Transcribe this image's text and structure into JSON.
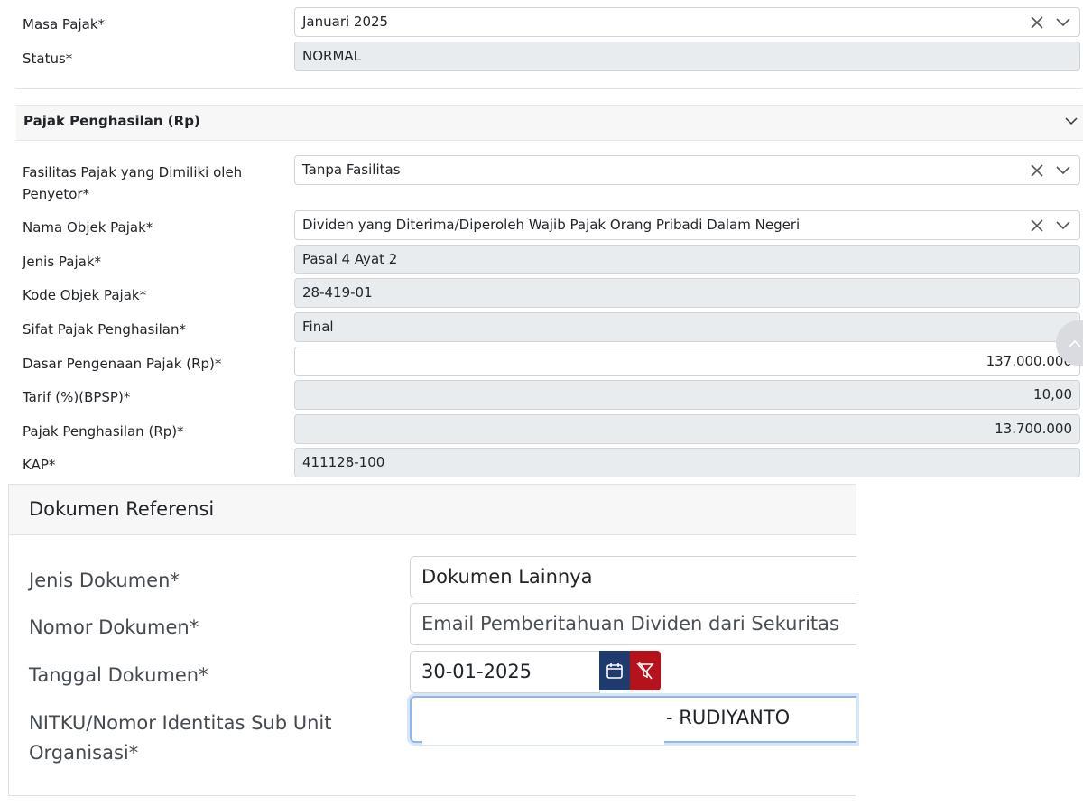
{
  "top": {
    "masa_pajak": {
      "label": "Masa Pajak*",
      "value": "Januari 2025"
    },
    "status": {
      "label": "Status*",
      "value": "NORMAL"
    }
  },
  "section": {
    "title": "Pajak Penghasilan (Rp)"
  },
  "fields": {
    "fasilitas": {
      "label_line1": "Fasilitas Pajak yang Dimiliki oleh",
      "label_line2": "Penyetor*",
      "value": "Tanpa Fasilitas"
    },
    "nama_objek": {
      "label": "Nama Objek Pajak*",
      "value": "Dividen yang Diterima/Diperoleh Wajib Pajak Orang Pribadi Dalam Negeri"
    },
    "jenis_pajak": {
      "label": "Jenis Pajak*",
      "value": "Pasal 4 Ayat 2"
    },
    "kode_objek": {
      "label": "Kode Objek Pajak*",
      "value": "28-419-01"
    },
    "sifat": {
      "label": "Sifat Pajak Penghasilan*",
      "value": "Final"
    },
    "dasar": {
      "label": "Dasar Pengenaan Pajak (Rp)*",
      "value": "137.000.000"
    },
    "tarif": {
      "label": "Tarif (%)(BPSP)*",
      "value": "10,00"
    },
    "pph": {
      "label": "Pajak Penghasilan (Rp)*",
      "value": "13.700.000"
    },
    "kap": {
      "label": "KAP*",
      "value": "411128-100"
    }
  },
  "dokumen": {
    "title": "Dokumen Referensi",
    "jenis": {
      "label": "Jenis Dokumen*",
      "value": "Dokumen Lainnya"
    },
    "nomor": {
      "label": "Nomor Dokumen*",
      "value": "Email Pemberitahuan Dividen dari Sekuritas"
    },
    "tanggal": {
      "label": "Tanggal Dokumen*",
      "value": "30-01-2025"
    },
    "nitku": {
      "label_line1": "NITKU/Nomor Identitas Sub Unit",
      "label_line2": "Organisasi*",
      "value": "- RUDIYANTO"
    }
  },
  "icons": {
    "clear": "close-icon",
    "dropdown": "chevron-down-icon",
    "calendar": "calendar-icon",
    "filter_clear": "filter-clear-icon",
    "scroll": "scroll-top-button"
  },
  "colors": {
    "calendar_btn": "#1f3a6d",
    "clear_btn": "#b5121b",
    "readonly_bg": "#e9ecef"
  }
}
